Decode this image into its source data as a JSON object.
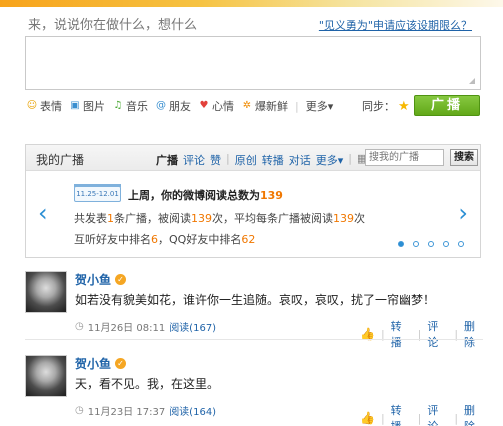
{
  "composer": {
    "prompt": "来，说说你在做什么，想什么",
    "help_link": "\"见义勇为\"申请应该设期限么？",
    "tools": [
      {
        "icon": "smiley-icon",
        "glyph": "☺",
        "label": "表情",
        "color": "#e8a100"
      },
      {
        "icon": "image-icon",
        "glyph": "▣",
        "label": "图片",
        "color": "#3a8fd0"
      },
      {
        "icon": "music-icon",
        "glyph": "♫",
        "label": "音乐",
        "color": "#49a832"
      },
      {
        "icon": "at-icon",
        "glyph": "@",
        "label": "朋友",
        "color": "#3a8fd0"
      },
      {
        "icon": "heart-icon",
        "glyph": "♥",
        "label": "心情",
        "color": "#e2403a"
      },
      {
        "icon": "burst-icon",
        "glyph": "✲",
        "label": "爆新鲜",
        "color": "#f08a00"
      }
    ],
    "more": "更多▾",
    "sync_label": "同步：",
    "post_button": "广播"
  },
  "panel": {
    "title": "我的广播",
    "tabs": [
      "广播",
      "评论",
      "赞",
      "原创",
      "转播",
      "对话",
      "更多▾"
    ],
    "search_placeholder": "搜我的广播",
    "search_button": "搜索",
    "date_range": "11.25-12.01",
    "week_prefix": "上周，你的微博阅读总数为",
    "week_total": "139",
    "line1_a": "共发表",
    "line1_n1": "1",
    "line1_b": "条广播，被阅读",
    "line1_n2": "139",
    "line1_c": "次，平均每条广播被阅读",
    "line1_n3": "139",
    "line1_d": "次",
    "line2_a": "互听好友中排名",
    "line2_n1": "6",
    "line2_b": "，QQ好友中排名",
    "line2_n2": "62",
    "pager_active": 0,
    "pager_count": 5
  },
  "feed": [
    {
      "author": "贺小鱼",
      "text": "如若没有貌美如花，谁许你一生追随。哀叹，哀叹，扰了一帘幽梦！",
      "date": "11月26日 08:11",
      "read": "阅读(167)",
      "actions": [
        "转播",
        "评论",
        "删除"
      ]
    },
    {
      "author": "贺小鱼",
      "text": "天，看不见。我，在这里。",
      "date": "11月23日 17:37",
      "read": "阅读(164)",
      "actions": [
        "转播",
        "评论",
        "删除"
      ]
    }
  ]
}
